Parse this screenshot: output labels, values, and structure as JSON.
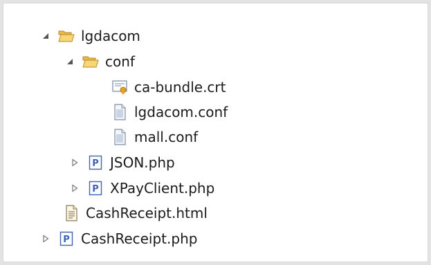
{
  "tree": {
    "root": {
      "label": "lgdacom",
      "icon": "open-folder-icon",
      "state": "expanded"
    },
    "conf": {
      "label": "conf",
      "icon": "open-folder-icon",
      "state": "expanded"
    },
    "ca_bundle": {
      "label": "ca-bundle.crt",
      "icon": "certificate-file-icon"
    },
    "lgdacom_conf": {
      "label": "lgdacom.conf",
      "icon": "text-file-icon"
    },
    "mall_conf": {
      "label": "mall.conf",
      "icon": "text-file-icon"
    },
    "json_php": {
      "label": "JSON.php",
      "icon": "php-file-icon",
      "state": "collapsed"
    },
    "xpay_php": {
      "label": "XPayClient.php",
      "icon": "php-file-icon",
      "state": "collapsed"
    },
    "cashreceipt_html": {
      "label": "CashReceipt.html",
      "icon": "html-file-icon"
    },
    "cashreceipt_php": {
      "label": "CashReceipt.php",
      "icon": "php-file-icon",
      "state": "collapsed"
    }
  },
  "colors": {
    "folder": "#e8b84a",
    "php_icon": "#3e62b5",
    "certificate": "#e6a024",
    "twistie": "#555555"
  }
}
